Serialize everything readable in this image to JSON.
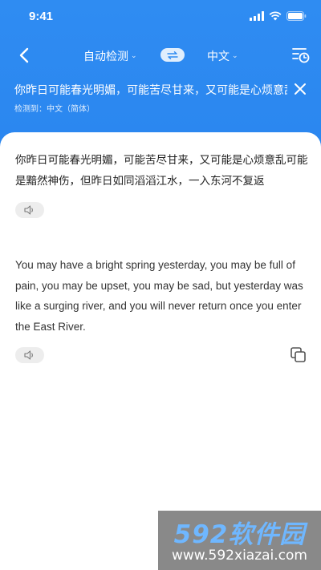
{
  "status_bar": {
    "time": "9:41"
  },
  "nav": {
    "source_language": "自动检测",
    "target_language": "中文"
  },
  "source": {
    "text": "你昨日可能春光明媚，可能苦尽甘来，又可能是心烦意乱可能是黯然神伤，但昨日如同滔滔江水，一入东河不复返",
    "detected_label": "检测到：中文（简体）"
  },
  "result": {
    "original_text": "你昨日可能春光明媚，可能苦尽甘来，又可能是心烦意乱可能是黯然神伤，但昨日如同滔滔江水，一入东河不复返",
    "translation": "You may have a bright spring yesterday, you may be full of pain, you may be upset, you may be sad, but yesterday was like a surging river, and you will never return once you enter the East River."
  },
  "watermark": {
    "logo": "592软件园",
    "url": "www.592xiazai.com"
  },
  "colors": {
    "header_blue": "#2f8cf2",
    "card_bg": "#ffffff",
    "text": "#222222"
  }
}
